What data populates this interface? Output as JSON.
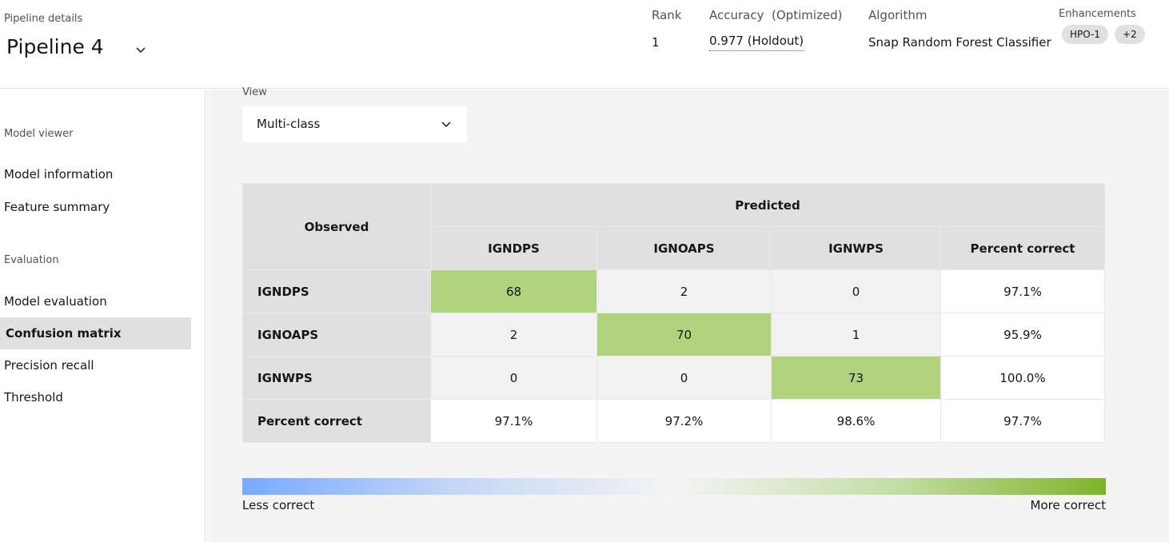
{
  "header": {
    "section_label": "Pipeline details",
    "pipeline_name": "Pipeline 4",
    "rank_title": "Rank",
    "rank_value": "1",
    "accuracy_title": "Accuracy  (Optimized)",
    "accuracy_value": "0.977 (Holdout)",
    "algorithm_title": "Algorithm",
    "algorithm_value": "Snap Random Forest Classifier",
    "enhancements_title": "Enhancements",
    "tags": [
      "HPO-1",
      "+2"
    ]
  },
  "sidebar": {
    "section_model_viewer": "Model viewer",
    "model_information": "Model information",
    "feature_summary": "Feature summary",
    "section_evaluation": "Evaluation",
    "model_evaluation": "Model evaluation",
    "confusion_matrix": "Confusion matrix",
    "precision_recall": "Precision recall",
    "threshold": "Threshold"
  },
  "view": {
    "label": "View",
    "selected": "Multi-class"
  },
  "matrix": {
    "observed_header": "Observed",
    "predicted_header": "Predicted",
    "columns": [
      "IGNDPS",
      "IGNOAPS",
      "IGNWPS",
      "Percent correct"
    ],
    "rows": [
      {
        "label": "IGNDPS",
        "cells": [
          "68",
          "2",
          "0",
          "97.1%"
        ]
      },
      {
        "label": "IGNOAPS",
        "cells": [
          "2",
          "70",
          "1",
          "95.9%"
        ]
      },
      {
        "label": "IGNWPS",
        "cells": [
          "0",
          "0",
          "73",
          "100.0%"
        ]
      },
      {
        "label": "Percent correct",
        "cells": [
          "97.1%",
          "97.2%",
          "98.6%",
          "97.7%"
        ]
      }
    ]
  },
  "legend": {
    "less": "Less correct",
    "more": "More correct"
  },
  "colors": {
    "correct_cell": "#b0d47e",
    "off_cell": "#f1f1f1",
    "gradient_low": "#78a9ff",
    "gradient_high": "#7fb42b"
  }
}
